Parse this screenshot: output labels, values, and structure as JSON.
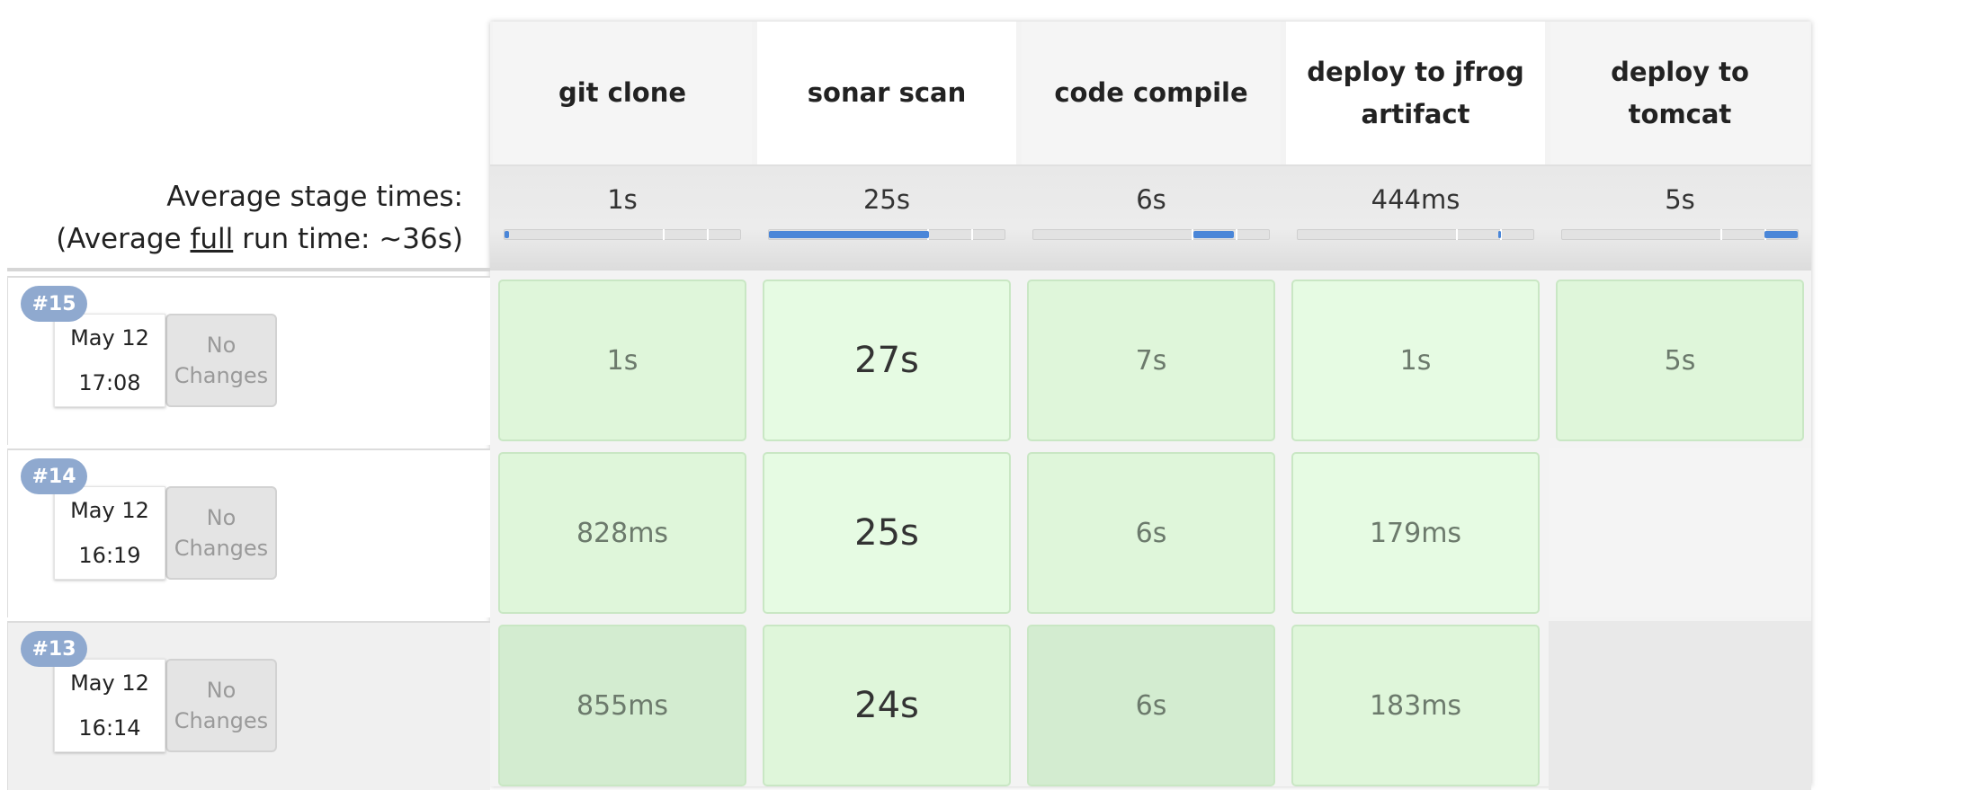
{
  "stages": [
    {
      "name": "git clone",
      "avg": "1s",
      "fill": 0.02,
      "fill_at": 0.0
    },
    {
      "name": "sonar scan",
      "avg": "25s",
      "fill": 0.68,
      "fill_at": 0.0
    },
    {
      "name": "code compile",
      "avg": "6s",
      "fill": 0.17,
      "fill_at": 0.68
    },
    {
      "name": "deploy to jfrog artifact",
      "avg": "444ms",
      "fill": 0.012,
      "fill_at": 0.85
    },
    {
      "name": "deploy to tomcat",
      "avg": "5s",
      "fill": 0.14,
      "fill_at": 0.86
    }
  ],
  "average": {
    "label_line1": "Average stage times:",
    "label_pre": "(Average ",
    "label_full": "full",
    "label_post": " run time: ~36s)"
  },
  "builds": [
    {
      "number": "#15",
      "date": "May 12",
      "time": "17:08",
      "changes_line1": "No",
      "changes_line2": "Changes",
      "durations": [
        "1s",
        "27s",
        "7s",
        "1s",
        "5s"
      ]
    },
    {
      "number": "#14",
      "date": "May 12",
      "time": "16:19",
      "changes_line1": "No",
      "changes_line2": "Changes",
      "durations": [
        "828ms",
        "25s",
        "6s",
        "179ms",
        null
      ]
    },
    {
      "number": "#13",
      "date": "May 12",
      "time": "16:14",
      "changes_line1": "No",
      "changes_line2": "Changes",
      "durations": [
        "855ms",
        "24s",
        "6s",
        "183ms",
        null
      ]
    }
  ],
  "colors": {
    "success_light": "#e6fbe3",
    "success": "#dff6da",
    "success_dark": "#d3ecd0",
    "bar_fill": "#4a86d8",
    "badge": "#8fa9cf"
  }
}
